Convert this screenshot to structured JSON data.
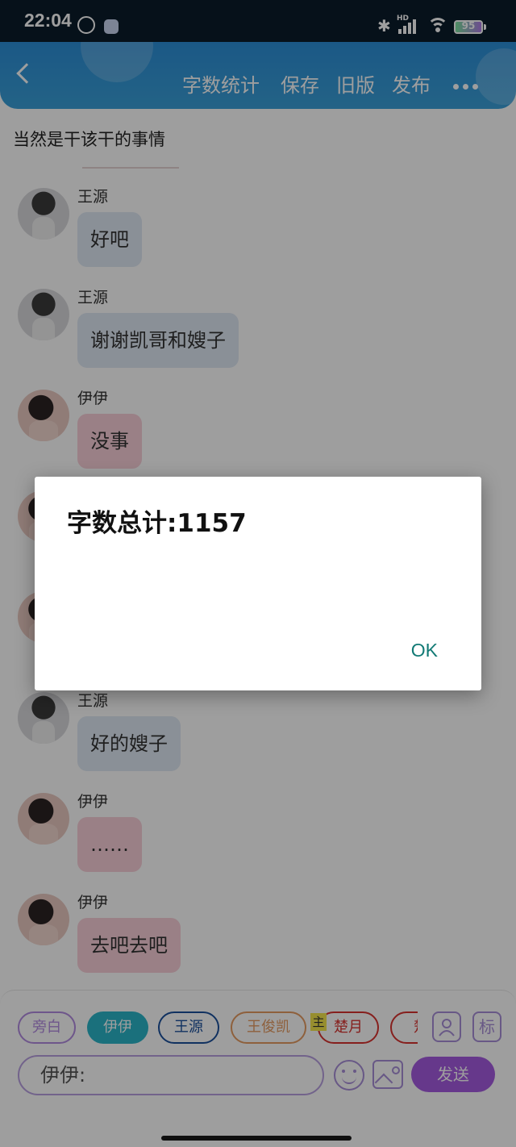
{
  "status_bar": {
    "time": "22:04",
    "hd_label": "HD",
    "battery": "95"
  },
  "header": {
    "menu": [
      "字数统计",
      "保存",
      "旧版",
      "发布"
    ]
  },
  "chat": {
    "top_text": "当然是干该干的事情",
    "messages": [
      {
        "sender": "王源",
        "text": "好吧",
        "side": "blue",
        "avatar": "boy"
      },
      {
        "sender": "王源",
        "text": "谢谢凯哥和嫂子",
        "side": "blue",
        "avatar": "boy"
      },
      {
        "sender": "伊伊",
        "text": "没事",
        "side": "pink",
        "avatar": "girl"
      },
      {
        "sender": "",
        "text": "",
        "side": "pink",
        "avatar": "girl"
      },
      {
        "sender": "",
        "text": "",
        "side": "pink",
        "avatar": "girl"
      },
      {
        "sender": "王源",
        "text": "好的嫂子",
        "side": "blue",
        "avatar": "boy"
      },
      {
        "sender": "伊伊",
        "text": "……",
        "side": "pink",
        "avatar": "girl"
      },
      {
        "sender": "伊伊",
        "text": "去吧去吧",
        "side": "pink",
        "avatar": "girl"
      }
    ]
  },
  "bottom": {
    "roles": [
      {
        "label": "旁白",
        "color": "#b28be0",
        "active": false
      },
      {
        "label": "伊伊",
        "color": "#2ab5c9",
        "active": true
      },
      {
        "label": "王源",
        "color": "#1b4f9c",
        "active": false
      },
      {
        "label": "王俊凯",
        "color": "#e59b62",
        "active": false
      },
      {
        "label": "楚月",
        "color": "#d8332f",
        "active": false
      },
      {
        "label": "楚",
        "color": "#d8332f",
        "active": false
      }
    ],
    "main_tag": "主",
    "side_icon_label": "标",
    "input_value": "伊伊:",
    "send_label": "发送"
  },
  "dialog": {
    "message": "字数总计:1157",
    "ok_label": "OK"
  },
  "colors": {
    "header": "#2c8fd8",
    "send": "#a55be0",
    "ok": "#127a75",
    "bubble_blue": "#dfe8f4",
    "bubble_pink": "#f8cfd8"
  }
}
